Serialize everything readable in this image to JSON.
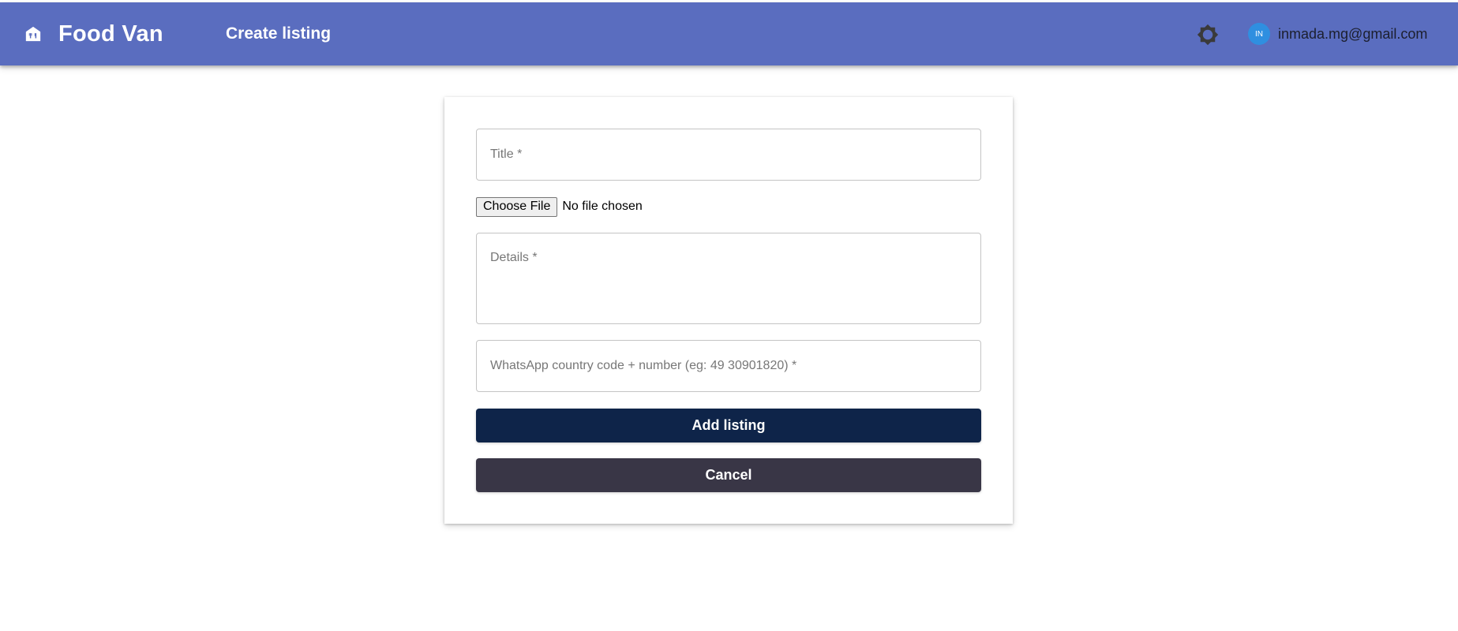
{
  "header": {
    "brand_name": "Food Van",
    "brand_icon": "storefront-icon",
    "nav_link_label": "Create listing",
    "theme_icon": "brightness-icon",
    "user": {
      "avatar_initials": "IN",
      "email": "inmada.mg@gmail.com"
    }
  },
  "form": {
    "title_placeholder": "Title *",
    "title_value": "",
    "file_button_label": "Choose File",
    "file_status": "No file chosen",
    "details_placeholder": "Details *",
    "details_value": "",
    "whatsapp_placeholder": "WhatsApp country code + number (eg: 49 30901820) *",
    "whatsapp_value": "",
    "submit_label": "Add listing",
    "cancel_label": "Cancel"
  },
  "colors": {
    "appbar": "#5a6dbf",
    "primary_button": "#0e2449",
    "secondary_button": "#393646",
    "avatar": "#2f8fe0"
  }
}
